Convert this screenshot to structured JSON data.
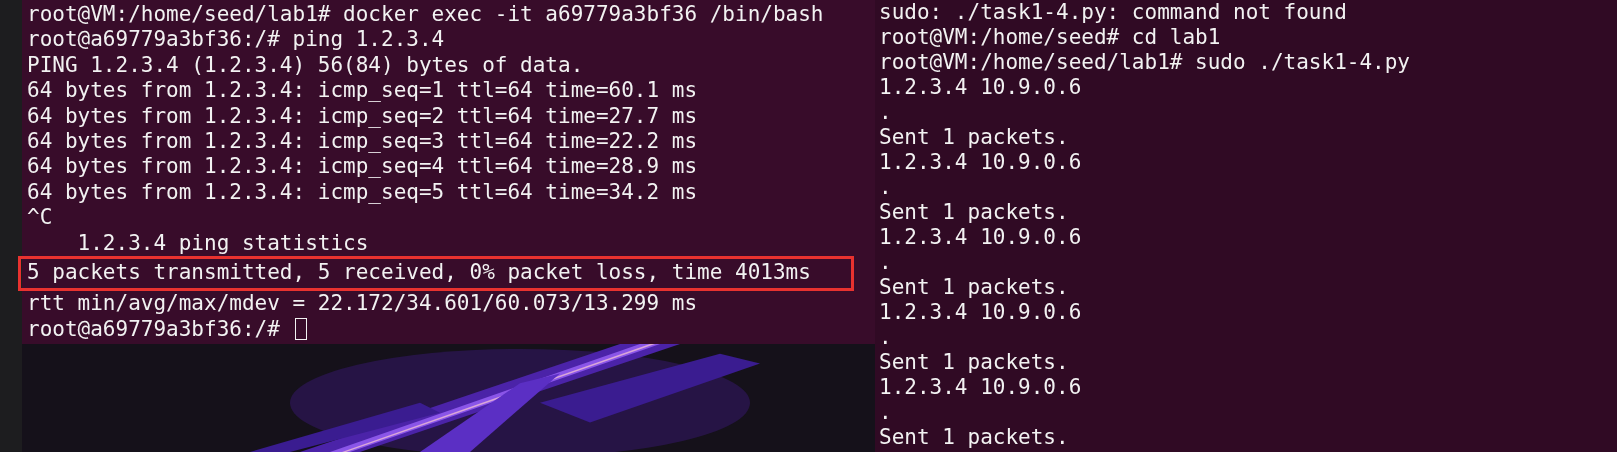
{
  "left_terminal": {
    "lines": [
      {
        "kind": "text",
        "text": "root@VM:/home/seed/lab1# docker exec -it a69779a3bf36 /bin/bash"
      },
      {
        "kind": "text",
        "text": "root@a69779a3bf36:/# ping 1.2.3.4"
      },
      {
        "kind": "text",
        "text": "PING 1.2.3.4 (1.2.3.4) 56(84) bytes of data."
      },
      {
        "kind": "text",
        "text": "64 bytes from 1.2.3.4: icmp_seq=1 ttl=64 time=60.1 ms"
      },
      {
        "kind": "text",
        "text": "64 bytes from 1.2.3.4: icmp_seq=2 ttl=64 time=27.7 ms"
      },
      {
        "kind": "text",
        "text": "64 bytes from 1.2.3.4: icmp_seq=3 ttl=64 time=22.2 ms"
      },
      {
        "kind": "text",
        "text": "64 bytes from 1.2.3.4: icmp_seq=4 ttl=64 time=28.9 ms"
      },
      {
        "kind": "text",
        "text": "64 bytes from 1.2.3.4: icmp_seq=5 ttl=64 time=34.2 ms"
      },
      {
        "kind": "text",
        "text": "^C"
      },
      {
        "kind": "text",
        "text": "    1.2.3.4 ping statistics"
      },
      {
        "kind": "boxed",
        "text": "5 packets transmitted, 5 received, 0% packet loss, time 4013ms"
      },
      {
        "kind": "text",
        "text": "rtt min/avg/max/mdev = 22.172/34.601/60.073/13.299 ms"
      },
      {
        "kind": "prompt",
        "text": "root@a69779a3bf36:/# "
      }
    ]
  },
  "right_terminal": {
    "lines": [
      "sudo: ./task1-4.py: command not found",
      "root@VM:/home/seed# cd lab1",
      "root@VM:/home/seed/lab1# sudo ./task1-4.py",
      "1.2.3.4 10.9.0.6",
      ".",
      "Sent 1 packets.",
      "1.2.3.4 10.9.0.6",
      ".",
      "Sent 1 packets.",
      "1.2.3.4 10.9.0.6",
      ".",
      "Sent 1 packets.",
      "1.2.3.4 10.9.0.6",
      ".",
      "Sent 1 packets.",
      "1.2.3.4 10.9.0.6",
      ".",
      "Sent 1 packets."
    ]
  }
}
